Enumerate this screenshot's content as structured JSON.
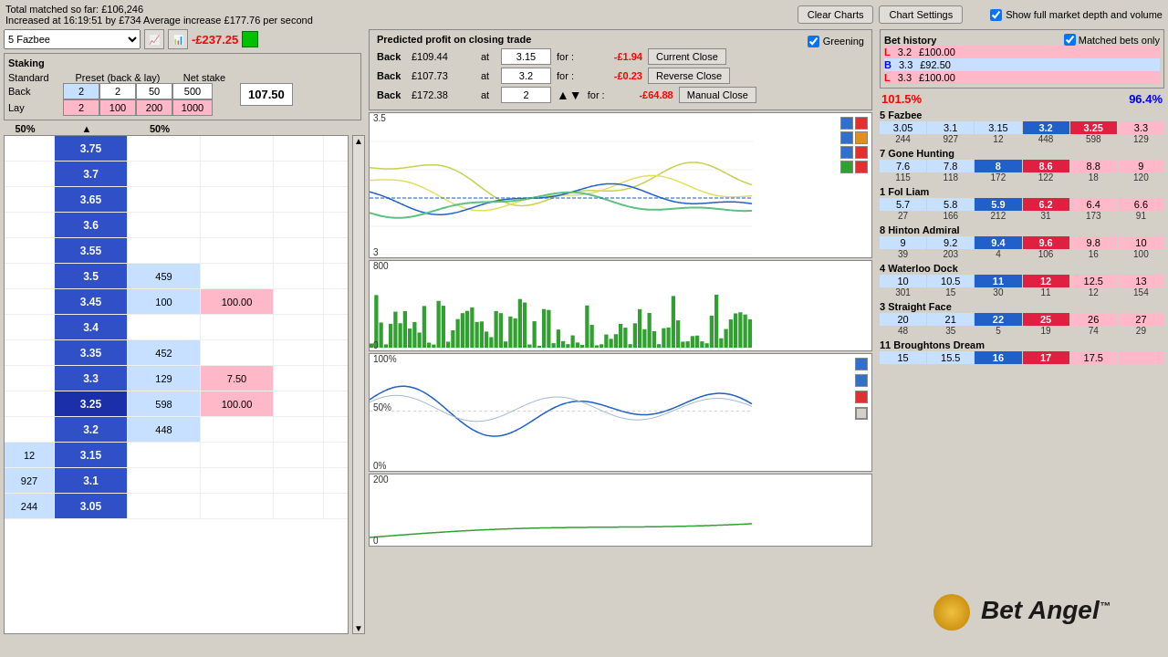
{
  "topInfo": {
    "line1": "Total matched so far: £106,246",
    "line2": "Increased at 16:19:51 by £734  Average increase £177.76 per second"
  },
  "toolbar": {
    "clearCharts": "Clear Charts",
    "chartSettings": "Chart Settings"
  },
  "depthVolume": {
    "label": "Show full market depth and volume"
  },
  "selector": {
    "horse": "5 Fazbee",
    "loss": "-£237.25"
  },
  "staking": {
    "title": "Staking",
    "standardLabel": "Standard",
    "presetLabel": "Preset (back & lay)",
    "netStakeLabel": "Net stake",
    "backLabel": "Back",
    "layLabel": "Lay",
    "backVal": "2",
    "layVal": "2",
    "preset1": "2",
    "preset2": "50",
    "preset3": "500",
    "preset4": "100",
    "preset5": "200",
    "preset6": "1000",
    "netStake": "107.50"
  },
  "ladder": {
    "col1Pct": "50%",
    "col3Pct": "50%",
    "rows": [
      {
        "left": "",
        "price": "3.75",
        "vol": "",
        "lay": "",
        "right": "",
        "priceType": "normal"
      },
      {
        "left": "",
        "price": "3.7",
        "vol": "",
        "lay": "",
        "right": "",
        "priceType": "normal"
      },
      {
        "left": "",
        "price": "3.65",
        "vol": "",
        "lay": "",
        "right": "",
        "priceType": "normal"
      },
      {
        "left": "",
        "price": "3.6",
        "vol": "",
        "lay": "",
        "right": "",
        "priceType": "normal"
      },
      {
        "left": "",
        "price": "3.55",
        "vol": "",
        "lay": "",
        "right": "",
        "priceType": "normal"
      },
      {
        "left": "",
        "price": "3.5",
        "vol": "459",
        "lay": "",
        "right": "",
        "priceType": "normal"
      },
      {
        "left": "",
        "price": "3.45",
        "vol": "100",
        "lay": "100.00",
        "right": "",
        "priceType": "normal"
      },
      {
        "left": "",
        "price": "3.4",
        "vol": "",
        "lay": "",
        "right": "",
        "priceType": "normal"
      },
      {
        "left": "",
        "price": "3.35",
        "vol": "452",
        "lay": "",
        "right": "",
        "priceType": "normal"
      },
      {
        "left": "",
        "price": "3.3",
        "vol": "129",
        "lay": "7.50",
        "right": "",
        "priceType": "normal"
      },
      {
        "left": "",
        "price": "3.25",
        "vol": "598",
        "lay": "100.00",
        "right": "",
        "priceType": "current"
      },
      {
        "left": "",
        "price": "3.2",
        "vol": "448",
        "lay": "",
        "right": "",
        "priceType": "normal"
      },
      {
        "left": "12",
        "price": "3.15",
        "vol": "",
        "lay": "",
        "right": "",
        "priceType": "normal"
      },
      {
        "left": "927",
        "price": "3.1",
        "vol": "",
        "lay": "",
        "right": "",
        "priceType": "normal"
      },
      {
        "left": "244",
        "price": "3.05",
        "vol": "",
        "lay": "",
        "right": "",
        "priceType": "normal"
      }
    ]
  },
  "profit": {
    "title": "Predicted profit on closing trade",
    "greeningLabel": "Greening",
    "rows": [
      {
        "label": "Back",
        "amount": "£109.44",
        "at": "at",
        "price": "3.15",
        "for": "for :",
        "result": "-£1.94",
        "btnLabel": "Current Close"
      },
      {
        "label": "Back",
        "amount": "£107.73",
        "at": "at",
        "price": "3.2",
        "for": "for :",
        "result": "-£0.23",
        "btnLabel": "Reverse Close"
      },
      {
        "label": "Back",
        "amount": "£172.38",
        "at": "at",
        "price": "2",
        "for": "for :",
        "result": "-£64.88",
        "btnLabel": "Manual Close"
      }
    ]
  },
  "betHistory": {
    "title": "Bet history",
    "matchedOnly": "Matched bets only",
    "rows": [
      {
        "type": "L",
        "odds": "3.2",
        "amount": "£100.00"
      },
      {
        "type": "B",
        "odds": "3.3",
        "amount": "£92.50"
      },
      {
        "type": "L",
        "odds": "3.3",
        "amount": "£100.00"
      }
    ]
  },
  "market": {
    "pct1": "101.5%",
    "pct2": "96.4%",
    "runners": [
      {
        "name": "5 Fazbee",
        "prices": [
          "3.05",
          "3.1",
          "3.15",
          "3.2",
          "3.25",
          "3.3"
        ],
        "vols": [
          "244",
          "927",
          "12",
          "448",
          "598",
          "129"
        ],
        "highlight": 3
      },
      {
        "name": "7 Gone Hunting",
        "prices": [
          "7.6",
          "7.8",
          "8",
          "8.6",
          "8.8",
          "9"
        ],
        "vols": [
          "115",
          "118",
          "172",
          "122",
          "18",
          "120"
        ],
        "highlight": 2
      },
      {
        "name": "1 Fol Liam",
        "prices": [
          "5.7",
          "5.8",
          "5.9",
          "6.2",
          "6.4",
          "6.6"
        ],
        "vols": [
          "27",
          "166",
          "212",
          "31",
          "173",
          "91"
        ],
        "highlight": 2
      },
      {
        "name": "8 Hinton Admiral",
        "prices": [
          "9",
          "9.2",
          "9.4",
          "9.6",
          "9.8",
          "10"
        ],
        "vols": [
          "39",
          "203",
          "4",
          "106",
          "16",
          "100"
        ],
        "highlight": 2
      },
      {
        "name": "4 Waterloo Dock",
        "prices": [
          "10",
          "10.5",
          "11",
          "12",
          "12.5",
          "13"
        ],
        "vols": [
          "301",
          "15",
          "30",
          "11",
          "12",
          "154"
        ],
        "highlight": 2
      },
      {
        "name": "3 Straight Face",
        "prices": [
          "20",
          "21",
          "22",
          "25",
          "26",
          "27"
        ],
        "vols": [
          "48",
          "35",
          "5",
          "19",
          "74",
          "29"
        ],
        "highlight": 2
      },
      {
        "name": "11 Broughtons Dream",
        "prices": [
          "15",
          "15.5",
          "16",
          "17",
          "17.5",
          ""
        ],
        "vols": [
          "",
          "",
          "",
          "",
          "",
          ""
        ],
        "highlight": 2
      }
    ]
  },
  "charts": {
    "yMax1": 3.5,
    "yMin1": 3.0,
    "yMax2": 800,
    "yMax3": "100%",
    "yMax4": 200
  }
}
